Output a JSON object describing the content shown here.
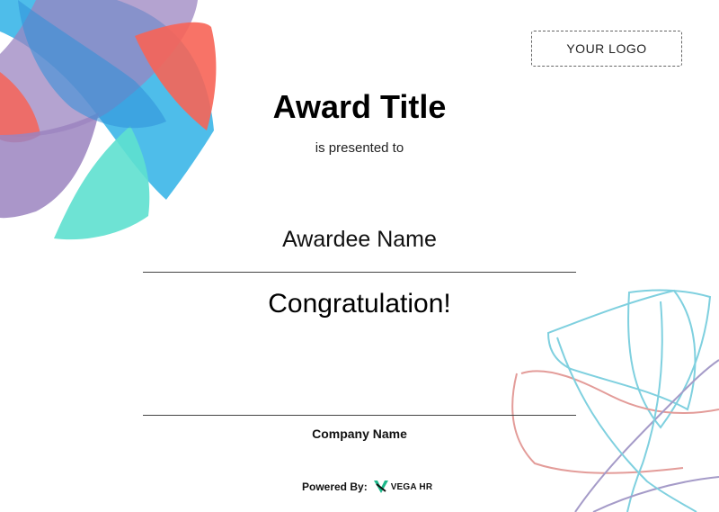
{
  "certificate": {
    "logo_placeholder": "YOUR LOGO",
    "award_title": "Award Title",
    "presented_text": "is presented to",
    "awardee_name": "Awardee Name",
    "congratulation": "Congratulation!",
    "company_name": "Company Name",
    "powered_by_label": "Powered By:",
    "brand_name": "VEGA HR"
  },
  "colors": {
    "blue": "#3bb6e8",
    "purple": "#9b84c0",
    "coral": "#f76457",
    "teal": "#5ee0cf",
    "brand_green": "#1db88a"
  }
}
